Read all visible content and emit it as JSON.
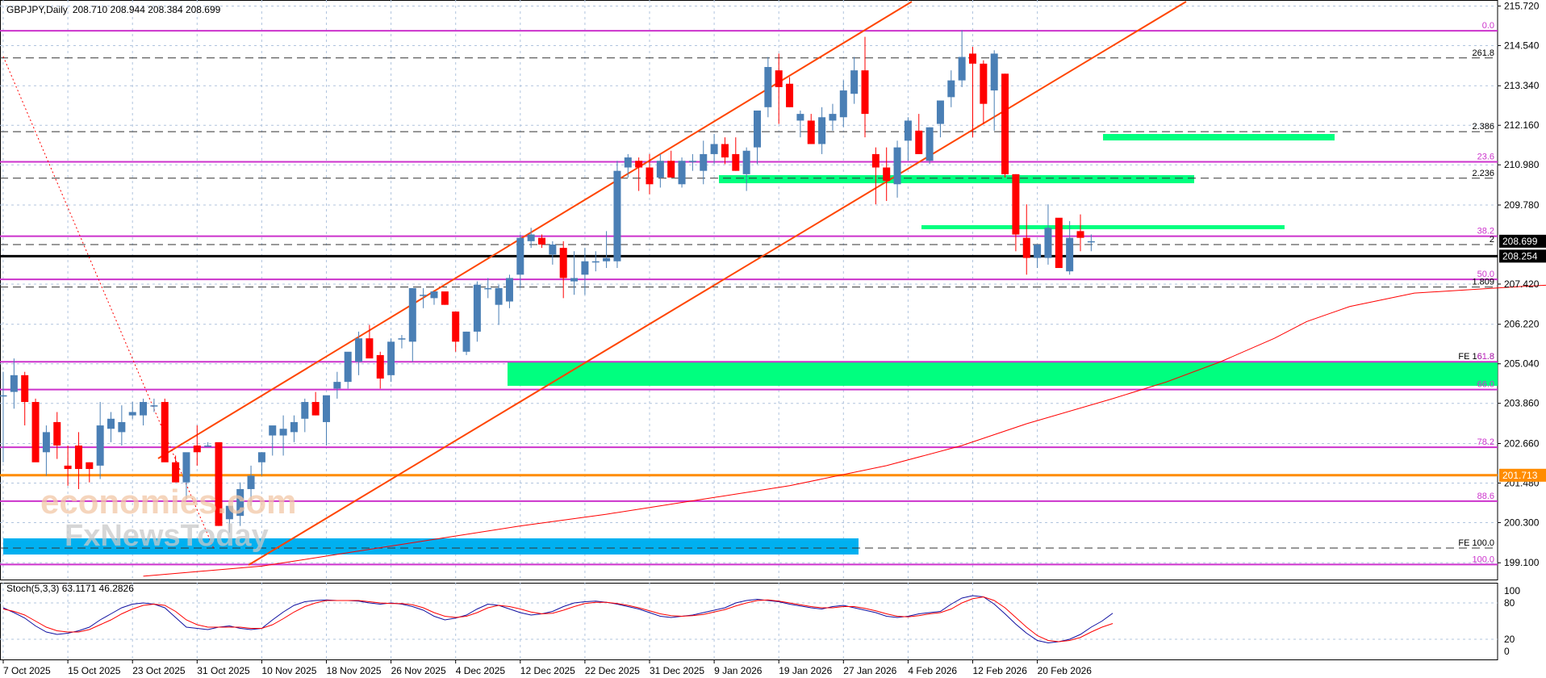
{
  "header": {
    "symbol": "GBPJPY,Daily",
    "ohlc": "208.710 208.944 208.384 208.699"
  },
  "indicator": {
    "label": "Stoch(5,3,3) 63.1171 46.2826"
  },
  "watermark": {
    "line1": "economies.com",
    "line2": "FxNewsToday"
  },
  "colors": {
    "bull": "#4a7fb5",
    "bear": "#ff0000",
    "fib": "#cc33cc",
    "channel": "#ff4500",
    "zone": "#00ff7f",
    "zone_blue": "#00b0f0",
    "ma": "#ff0000",
    "support": "#ff8c00",
    "price_box": "#000000",
    "grid": "#b0c4de",
    "stoch_main": "#1010a0",
    "stoch_signal": "#ff0000"
  },
  "chart_data": [
    {
      "type": "candlestick",
      "title": "GBPJPY,Daily",
      "y_axis_ticks": [
        "215.720",
        "214.540",
        "213.340",
        "212.160",
        "210.980",
        "209.780",
        "207.420",
        "206.220",
        "205.040",
        "203.860",
        "202.660",
        "201.480",
        "200.300",
        "199.100"
      ],
      "ylim": [
        198.6,
        215.9
      ],
      "x_axis_ticks": [
        "7 Oct 2025",
        "15 Oct 2025",
        "23 Oct 2025",
        "31 Oct 2025",
        "10 Nov 2025",
        "18 Nov 2025",
        "26 Nov 2025",
        "4 Dec 2025",
        "12 Dec 2025",
        "22 Dec 2025",
        "31 Dec 2025",
        "9 Jan 2026",
        "19 Jan 2026",
        "27 Jan 2026",
        "4 Feb 2026",
        "12 Feb 2026",
        "20 Feb 2026"
      ],
      "candles": [
        [
          204.1,
          204.8,
          202.1,
          204.1
        ],
        [
          204.2,
          205.2,
          203.7,
          204.7
        ],
        [
          204.7,
          204.8,
          203.2,
          203.9
        ],
        [
          203.9,
          204.0,
          202.6,
          202.1
        ],
        [
          202.4,
          203.2,
          201.7,
          203.0
        ],
        [
          203.3,
          203.6,
          202.2,
          202.6
        ],
        [
          202.0,
          202.6,
          201.4,
          201.9
        ],
        [
          202.6,
          203.0,
          201.3,
          201.9
        ],
        [
          202.1,
          202.1,
          201.5,
          201.9
        ],
        [
          202.0,
          203.9,
          201.6,
          203.2
        ],
        [
          203.1,
          203.6,
          202.7,
          203.4
        ],
        [
          203.0,
          203.8,
          202.6,
          203.3
        ],
        [
          203.5,
          203.9,
          203.4,
          203.6
        ],
        [
          203.5,
          204.0,
          203.2,
          203.9
        ],
        [
          203.8,
          204.0,
          203.6,
          203.8
        ],
        [
          203.9,
          204.0,
          202.6,
          202.1
        ],
        [
          202.1,
          202.3,
          201.6,
          201.5
        ],
        [
          201.5,
          202.2,
          201.0,
          202.4
        ],
        [
          202.6,
          203.2,
          202.0,
          202.4
        ],
        [
          202.6,
          202.7,
          202.6,
          202.6
        ],
        [
          202.7,
          202.6,
          200.2,
          200.2
        ],
        [
          200.4,
          200.7,
          200.0,
          200.8
        ],
        [
          200.5,
          201.5,
          200.2,
          201.3
        ],
        [
          201.3,
          202.0,
          200.8,
          201.7
        ],
        [
          202.1,
          202.4,
          201.7,
          202.4
        ],
        [
          202.9,
          203.1,
          202.3,
          203.2
        ],
        [
          202.9,
          203.5,
          202.3,
          203.1
        ],
        [
          203.0,
          203.5,
          202.7,
          203.3
        ],
        [
          203.4,
          204.0,
          203.0,
          203.9
        ],
        [
          203.9,
          204.2,
          203.5,
          203.5
        ],
        [
          203.3,
          204.0,
          202.6,
          204.1
        ],
        [
          204.3,
          204.8,
          204.0,
          204.5
        ],
        [
          204.5,
          205.1,
          204.3,
          205.4
        ],
        [
          205.1,
          206.0,
          204.7,
          205.8
        ],
        [
          205.8,
          206.2,
          205.5,
          205.2
        ],
        [
          205.3,
          205.4,
          204.3,
          204.6
        ],
        [
          204.7,
          205.8,
          204.5,
          205.7
        ],
        [
          205.8,
          205.9,
          205.5,
          205.8
        ],
        [
          205.7,
          207.2,
          205.1,
          207.3
        ],
        [
          207.1,
          207.3,
          206.7,
          207.1
        ],
        [
          207.0,
          207.2,
          206.8,
          207.2
        ],
        [
          207.2,
          207.1,
          206.8,
          206.8
        ],
        [
          206.6,
          206.6,
          205.4,
          205.7
        ],
        [
          205.4,
          206.0,
          205.3,
          206.0
        ],
        [
          206.0,
          207.5,
          205.7,
          207.4
        ],
        [
          207.3,
          207.6,
          207.0,
          207.3
        ],
        [
          206.8,
          207.4,
          206.2,
          207.3
        ],
        [
          206.9,
          207.7,
          206.7,
          207.6
        ],
        [
          207.7,
          208.9,
          207.3,
          208.8
        ],
        [
          208.7,
          209.1,
          208.5,
          208.9
        ],
        [
          208.8,
          208.9,
          208.5,
          208.6
        ],
        [
          208.3,
          208.7,
          208.0,
          208.6
        ],
        [
          208.5,
          208.7,
          207.0,
          207.6
        ],
        [
          207.5,
          208.4,
          207.1,
          207.6
        ],
        [
          207.7,
          208.5,
          207.1,
          208.1
        ],
        [
          208.1,
          208.4,
          207.8,
          208.1
        ],
        [
          208.1,
          209.0,
          207.9,
          208.2
        ],
        [
          208.1,
          211.1,
          207.9,
          210.8
        ],
        [
          210.9,
          211.3,
          210.6,
          211.2
        ],
        [
          211.1,
          211.2,
          210.2,
          210.9
        ],
        [
          210.9,
          211.3,
          210.1,
          210.4
        ],
        [
          210.6,
          211.3,
          210.3,
          211.1
        ],
        [
          211.1,
          211.4,
          210.7,
          210.6
        ],
        [
          210.4,
          211.2,
          210.3,
          211.1
        ],
        [
          211.1,
          211.3,
          210.8,
          211.1
        ],
        [
          210.8,
          211.7,
          210.4,
          211.3
        ],
        [
          211.3,
          211.9,
          211.0,
          211.6
        ],
        [
          211.6,
          211.8,
          211.0,
          211.2
        ],
        [
          211.3,
          211.8,
          210.8,
          210.8
        ],
        [
          210.7,
          211.5,
          210.2,
          211.4
        ],
        [
          211.5,
          212.2,
          211.0,
          212.6
        ],
        [
          212.7,
          214.2,
          212.4,
          213.9
        ],
        [
          213.8,
          214.3,
          212.2,
          213.3
        ],
        [
          213.4,
          213.6,
          212.7,
          212.7
        ],
        [
          212.3,
          212.6,
          211.8,
          212.5
        ],
        [
          212.3,
          212.5,
          211.6,
          211.6
        ],
        [
          211.6,
          212.7,
          211.3,
          212.4
        ],
        [
          212.3,
          212.8,
          212.0,
          212.5
        ],
        [
          212.4,
          213.5,
          212.1,
          213.2
        ],
        [
          213.1,
          214.2,
          212.8,
          213.8
        ],
        [
          213.8,
          214.8,
          211.8,
          212.5
        ],
        [
          211.3,
          211.5,
          209.8,
          210.9
        ],
        [
          210.9,
          211.5,
          209.9,
          210.5
        ],
        [
          210.4,
          211.7,
          210.0,
          211.5
        ],
        [
          211.7,
          212.4,
          211.1,
          212.3
        ],
        [
          212.0,
          212.5,
          211.3,
          211.3
        ],
        [
          211.1,
          212.1,
          211.0,
          212.1
        ],
        [
          212.2,
          212.8,
          211.8,
          212.9
        ],
        [
          213.0,
          213.8,
          212.7,
          213.5
        ],
        [
          213.5,
          215.0,
          213.3,
          214.2
        ],
        [
          214.3,
          214.5,
          211.8,
          214.0
        ],
        [
          214.0,
          214.1,
          212.2,
          212.8
        ],
        [
          213.2,
          214.4,
          212.0,
          214.3
        ],
        [
          213.7,
          213.7,
          210.6,
          210.7
        ],
        [
          210.7,
          210.7,
          208.4,
          208.9
        ],
        [
          208.8,
          209.8,
          207.7,
          208.2
        ],
        [
          208.2,
          208.6,
          207.9,
          208.6
        ],
        [
          208.2,
          209.8,
          208.0,
          209.1
        ],
        [
          209.4,
          209.3,
          208.0,
          207.9
        ],
        [
          207.8,
          209.3,
          207.7,
          208.8
        ],
        [
          209.0,
          209.5,
          208.4,
          208.8
        ],
        [
          208.7,
          208.9,
          208.4,
          208.7
        ]
      ],
      "ma_points": [
        [
          13,
          198.7
        ],
        [
          24,
          199.0
        ],
        [
          32,
          199.4
        ],
        [
          40,
          199.8
        ],
        [
          48,
          200.2
        ],
        [
          56,
          200.55
        ],
        [
          65,
          201.0
        ],
        [
          73,
          201.4
        ],
        [
          82,
          202.0
        ],
        [
          89,
          202.6
        ],
        [
          95,
          203.25
        ],
        [
          103,
          204.0
        ],
        [
          108,
          204.5
        ],
        [
          113,
          205.1
        ],
        [
          118,
          205.8
        ],
        [
          121,
          206.3
        ],
        [
          125,
          206.75
        ],
        [
          131,
          207.15
        ],
        [
          136,
          207.25
        ],
        [
          141,
          207.35
        ],
        [
          144,
          207.4
        ]
      ],
      "horizontal_levels": [
        {
          "label": "0.0",
          "value": 214.98,
          "kind": "fib"
        },
        {
          "label": "261.8",
          "value": 214.17,
          "kind": "dash"
        },
        {
          "label": "2.386",
          "value": 211.97,
          "kind": "dash"
        },
        {
          "label": "23.6",
          "value": 211.07,
          "kind": "fib"
        },
        {
          "label": "2.236",
          "value": 210.58,
          "kind": "dash"
        },
        {
          "label": "38.2",
          "value": 208.85,
          "kind": "fib"
        },
        {
          "label": "2",
          "value": 208.6,
          "kind": "dash"
        },
        {
          "label": "50.0",
          "value": 207.56,
          "kind": "fib"
        },
        {
          "label": "1.809",
          "value": 207.33,
          "kind": "dash"
        },
        {
          "label": "FE 161.8",
          "value": 205.1,
          "kind": "dash"
        },
        {
          "label": "61.8",
          "value": 205.1,
          "kind": "fib"
        },
        {
          "label": "66.0",
          "value": 204.27,
          "kind": "fib"
        },
        {
          "label": "78.2",
          "value": 202.55,
          "kind": "fib"
        },
        {
          "label": "88.6",
          "value": 200.94,
          "kind": "fib"
        },
        {
          "label": "FE 100.0",
          "value": 199.54,
          "kind": "dash"
        },
        {
          "label": "100.0",
          "value": 199.05,
          "kind": "fib"
        }
      ],
      "price_labels": [
        {
          "label": "208.699",
          "value": 208.699
        },
        {
          "label": "208.254",
          "value": 208.254
        },
        {
          "label": "201.713",
          "value": 201.713
        }
      ],
      "support_line": 201.713,
      "black_line": 208.254
    },
    {
      "type": "line",
      "title": "Stoch(5,3,3) 63.1171 46.2826",
      "ylim": [
        0,
        100
      ],
      "y_axis_ticks": [
        "100",
        "80",
        "20",
        "0"
      ],
      "series": [
        {
          "values": [
            72,
            64,
            55,
            42,
            32,
            28,
            30,
            34,
            40,
            52,
            62,
            72,
            78,
            80,
            78,
            72,
            56,
            40,
            38,
            36,
            40,
            42,
            38,
            36,
            38,
            52,
            65,
            76,
            82,
            84,
            85,
            84,
            84,
            83,
            80,
            78,
            80,
            78,
            74,
            68,
            58,
            52,
            55,
            60,
            70,
            78,
            76,
            70,
            64,
            60,
            62,
            66,
            74,
            80,
            82,
            83,
            81,
            78,
            74,
            70,
            64,
            58,
            56,
            58,
            60,
            64,
            68,
            72,
            80,
            84,
            86,
            84,
            82,
            78,
            75,
            72,
            70,
            74,
            76,
            72,
            68,
            64,
            58,
            56,
            58,
            62,
            64,
            66,
            78,
            88,
            92,
            90,
            78,
            62,
            45,
            30,
            18,
            14,
            16,
            20,
            28,
            40,
            50,
            63
          ]
        },
        {
          "values": [
            70,
            66,
            60,
            50,
            40,
            34,
            32,
            32,
            36,
            44,
            52,
            62,
            70,
            76,
            78,
            76,
            66,
            52,
            44,
            40,
            40,
            40,
            40,
            38,
            38,
            44,
            54,
            65,
            74,
            80,
            84,
            84,
            84,
            84,
            82,
            80,
            79,
            79,
            77,
            72,
            64,
            58,
            56,
            58,
            64,
            72,
            76,
            74,
            70,
            65,
            62,
            63,
            68,
            74,
            79,
            81,
            81,
            79,
            76,
            72,
            67,
            62,
            59,
            58,
            59,
            61,
            65,
            69,
            75,
            80,
            84,
            85,
            83,
            80,
            77,
            74,
            72,
            72,
            74,
            74,
            71,
            67,
            62,
            58,
            57,
            59,
            62,
            64,
            70,
            80,
            87,
            90,
            84,
            72,
            56,
            40,
            26,
            18,
            16,
            18,
            23,
            32,
            40,
            46
          ]
        }
      ]
    }
  ]
}
